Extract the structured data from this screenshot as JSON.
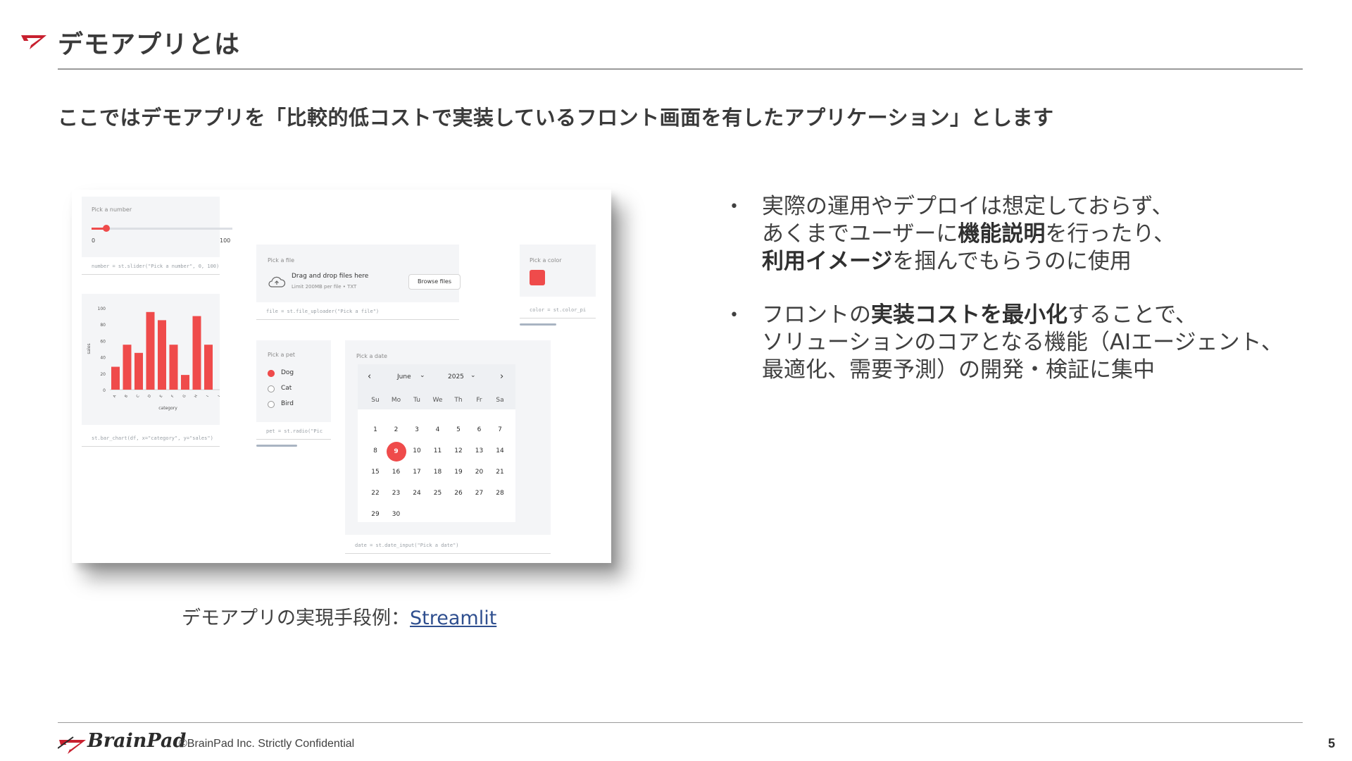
{
  "header": {
    "title": "デモアプリとは",
    "subtitle": "ここではデモアプリを「比較的低コストで実装しているフロント画面を有したアプリケーション」とします"
  },
  "demo": {
    "slider": {
      "label": "Pick a number",
      "min": "0",
      "max": "100",
      "value_fraction": 0.1,
      "code": "number = st.slider(\"Pick a number\", 0, 100)"
    },
    "chart": {
      "code": "st.bar_chart(df, x=\"category\", y=\"sales\")",
      "xlabel": "category",
      "ylabel": "sales",
      "yticks": [
        "100",
        "80",
        "60",
        "40",
        "20",
        "0"
      ]
    },
    "uploader": {
      "label": "Pick a file",
      "drop_text": "Drag and drop files here",
      "limit_text": "Limit 200MB per file • TXT",
      "button": "Browse files",
      "code": "file = st.file_uploader(\"Pick a file\")"
    },
    "color": {
      "label": "Pick a color",
      "value": "#ef4b4b",
      "code": "color = st.color_pi"
    },
    "radio": {
      "label": "Pick a pet",
      "options": [
        "Dog",
        "Cat",
        "Bird"
      ],
      "selected": "Dog",
      "code": "pet = st.radio(\"Pic"
    },
    "date": {
      "label": "Pick a date",
      "month": "June",
      "year": "2025",
      "weekdays": [
        "Su",
        "Mo",
        "Tu",
        "We",
        "Th",
        "Fr",
        "Sa"
      ],
      "selected_day": "9",
      "code": "date = st.date_input(\"Pick a date\")"
    }
  },
  "chart_data": {
    "type": "bar",
    "categories": [
      "A",
      "B",
      "C",
      "D",
      "E",
      "F",
      "G",
      "H",
      "I",
      "J"
    ],
    "values": [
      28,
      55,
      45,
      95,
      85,
      55,
      18,
      90,
      55,
      0
    ],
    "xlabel": "category",
    "ylabel": "sales",
    "ylim": [
      0,
      100
    ],
    "color": "#ef4b4b"
  },
  "caption": {
    "prefix": "デモアプリの実現手段例：",
    "link": "Streamlit"
  },
  "bullets": {
    "b1_l1": "実際の運用やデプロイは想定しておらず、",
    "b1_l2a": "あくまでユーザーに",
    "b1_l2b": "機能説明",
    "b1_l2c": "を行ったり、",
    "b1_l3a": "利用イメージ",
    "b1_l3b": "を掴んでもらうのに使用",
    "b2_l1a": "フロントの",
    "b2_l1b": "実装コストを最小化",
    "b2_l1c": "することで、",
    "b2_l2": "ソリューションのコアとなる機能（AIエージェント、",
    "b2_l3": "最適化、需要予測）の開発・検証に集中"
  },
  "footer": {
    "logo": "BrainPad",
    "copyright": "©BrainPad Inc.  Strictly Confidential",
    "page": "5"
  },
  "colors": {
    "accent": "#c8202f",
    "streamlit_red": "#ef4b4b"
  }
}
